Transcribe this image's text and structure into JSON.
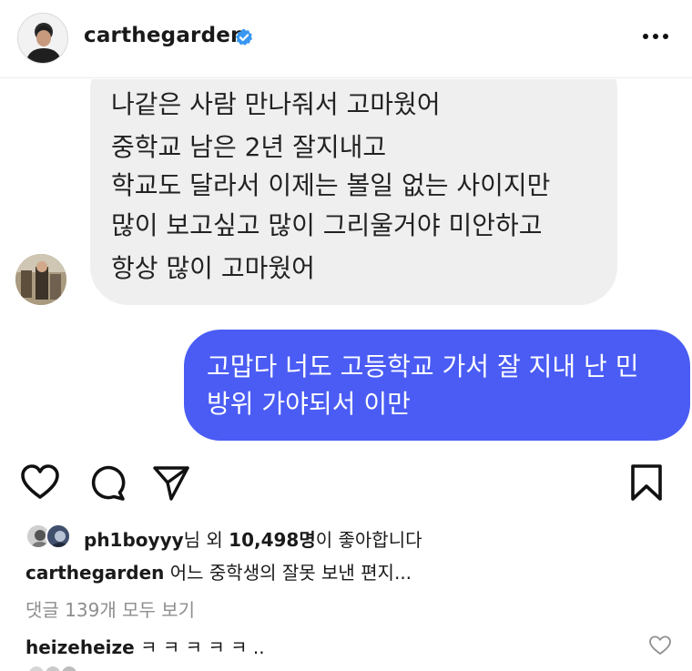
{
  "header": {
    "username": "carthegarden",
    "verified_color": "#3897f0"
  },
  "messages": {
    "incoming_lines": [
      "나같은 사람 만나줘서 고마웠어",
      "중학교 남은 2년 잘지내고",
      "학교도 달라서 이제는 볼일 없는 사이지만",
      "많이 보고싶고 많이 그리울거야 미안하고",
      "항상 많이  고마웠어"
    ],
    "outgoing_lines": [
      "고맙다 너도 고등학교 가서 잘 지내 난 민",
      "방위 가야되서 이만"
    ],
    "outgoing_bubble_color": "#4a5cf4"
  },
  "likes": {
    "user": "ph1boyyy",
    "middle": "님 외 ",
    "count": "10,498명",
    "suffix": "이 좋아합니다"
  },
  "caption": {
    "username": "carthegarden",
    "text": " 어느 중학생의 잘못 보낸 편지..."
  },
  "view_comments": "댓글 139개 모두 보기",
  "comment": {
    "username": "heizeheize",
    "text": " ㅋ ㅋ ㅋ ㅋ ㅋ .."
  }
}
